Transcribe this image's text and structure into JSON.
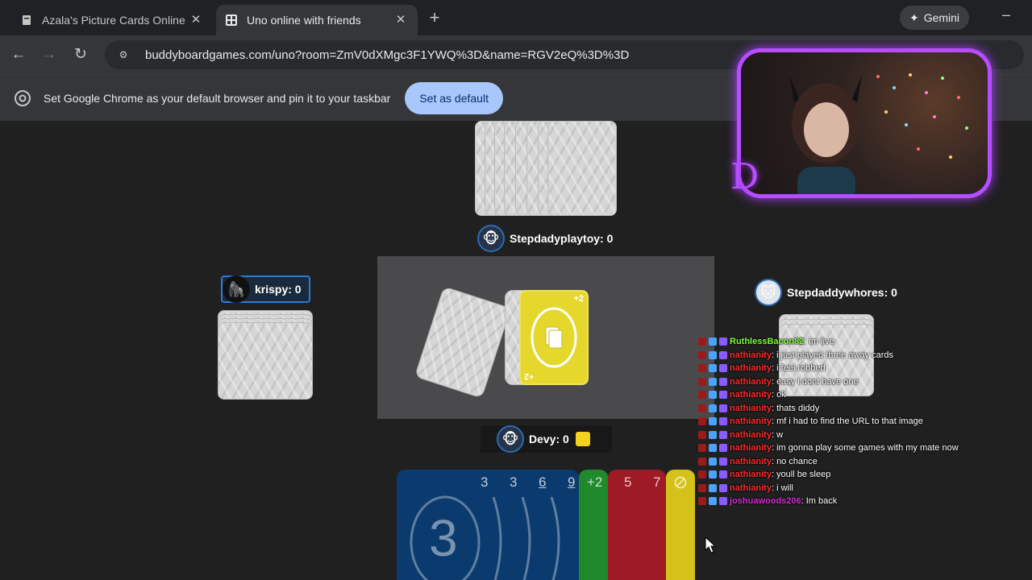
{
  "browser": {
    "tabs": [
      {
        "label": "Azala's Picture Cards Online"
      },
      {
        "label": "Uno online with friends"
      }
    ],
    "gemini_label": "Gemini",
    "url": "buddyboardgames.com/uno?room=ZmV0dXMgc3F1YWQ%3D&name=RGV2eQ%3D%3D",
    "infobar": {
      "message": "Set Google Chrome as your default browser and pin it to your taskbar",
      "button": "Set as default"
    }
  },
  "game": {
    "players": {
      "top": {
        "name": "Stepdadyplaytoy: 0"
      },
      "left": {
        "name": "krispy: 0"
      },
      "right": {
        "name": "Stepdaddywhores: 0"
      },
      "bottom": {
        "name": "Devy: 0"
      }
    },
    "current_color": "#f3d320",
    "discard_top": {
      "label": "+2",
      "color": "#e5d72c"
    },
    "hand_numbers": [
      "3",
      "3",
      "6",
      "9",
      "+2",
      "5",
      "7"
    ],
    "hand_big_number": "3"
  },
  "chat": {
    "messages": [
      {
        "user": "RuthlessBacon82",
        "text": ": im live",
        "user_color": "#7fff3a"
      },
      {
        "user": "nathianity",
        "text": ": i just played three away cards",
        "user_color": "#ff2a2a"
      },
      {
        "user": "nathianity",
        "text": ": i feel robbed",
        "user_color": "#ff2a2a"
      },
      {
        "user": "nathianity",
        "text": ": easy i dont have one",
        "user_color": "#ff2a2a"
      },
      {
        "user": "nathianity",
        "text": ": ok",
        "user_color": "#ff2a2a"
      },
      {
        "user": "nathianity",
        "text": ": thats diddy",
        "user_color": "#ff2a2a"
      },
      {
        "user": "nathianity",
        "text": ": mf i had to find the URL to that image",
        "user_color": "#ff2a2a"
      },
      {
        "user": "nathianity",
        "text": ": w",
        "user_color": "#ff2a2a"
      },
      {
        "user": "nathianity",
        "text": ": im gonna play some games with my mate now",
        "user_color": "#ff2a2a"
      },
      {
        "user": "nathianity",
        "text": ": no chance",
        "user_color": "#ff2a2a"
      },
      {
        "user": "nathianity",
        "text": ": youll be sleep",
        "user_color": "#ff2a2a"
      },
      {
        "user": "nathianity",
        "text": ": i will",
        "user_color": "#ff2a2a"
      },
      {
        "user": "joshuawoods206",
        "text": ": Im back",
        "user_color": "#d82bd8"
      }
    ]
  }
}
